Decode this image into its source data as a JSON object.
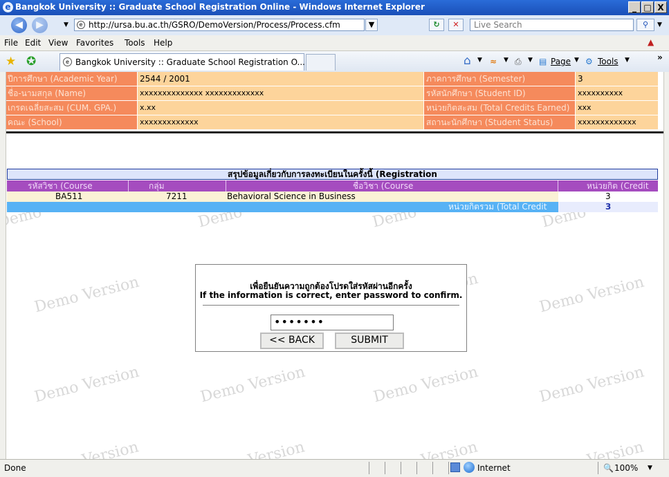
{
  "window": {
    "title": "Bangkok University :: Graduate School Registration Online - Windows Internet Explorer",
    "minimize": "_",
    "maximize": "□",
    "close": "X"
  },
  "address": {
    "url": "http://ursa.bu.ac.th/GSRO/DemoVersion/Process/Process.cfm",
    "search_placeholder": "Live Search"
  },
  "menu": [
    "File",
    "Edit",
    "View",
    "Favorites",
    "Tools",
    "Help"
  ],
  "tab": {
    "label": "Bangkok University :: Graduate School Registration O...",
    "page_label": "Page",
    "tools_label": "Tools"
  },
  "student_info": {
    "academic_year_label": "ปีการศึกษา (Academic Year)",
    "academic_year_value": "2544 / 2001",
    "semester_label": "ภาคการศึกษา (Semester)",
    "semester_value": "3",
    "name_label": "ชื่อ-นามสกุล (Name)",
    "name_value": "xxxxxxxxxxxxxx xxxxxxxxxxxxx",
    "student_id_label": "รหัสนักศึกษา (Student ID)",
    "student_id_value": "xxxxxxxxxx",
    "gpa_label": "เกรดเฉลี่ยสะสม (CUM. GPA.)",
    "gpa_value": "x.xx",
    "credits_earned_label": "หน่วยกิตสะสม (Total Credits Earned)",
    "credits_earned_value": "xxx",
    "school_label": "คณะ (School)",
    "school_value": "xxxxxxxxxxxxx",
    "status_label": "สถานะนักศึกษา (Student Status)",
    "status_value": "xxxxxxxxxxxxx"
  },
  "registration": {
    "title": "สรุปข้อมูลเกี่ยวกับการลงทะเบียนในครั้งนี้ (Registration",
    "columns": {
      "course": "รหัสวิชา (Course",
      "section": "กลุ่ม",
      "course_name": "ชื่อวิชา (Course",
      "credit": "หน่วยกิต (Credit"
    },
    "rows": [
      {
        "course": "BA511",
        "section": "7211",
        "name": "Behavioral Science in Business",
        "credit": "3"
      }
    ],
    "total_label": "หน่วยกิตรวม (Total Credit",
    "total_value": "3"
  },
  "watermark": {
    "demo": "Demo Version",
    "demo_short": "Demo",
    "version_short": "Version"
  },
  "confirm": {
    "thai_text": "เพื่อยืนยันความถูกต้องโปรดใส่รหัสผ่านอีกครั้ง",
    "english_text": "If the information is correct, enter password to confirm.",
    "password_value": "•••••••",
    "back_label": "<< BACK",
    "submit_label": "SUBMIT"
  },
  "status": {
    "text": "Done",
    "zone": "Internet",
    "zoom": "100%"
  }
}
